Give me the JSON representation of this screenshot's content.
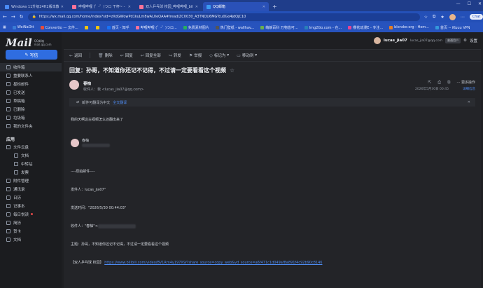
{
  "browser": {
    "tabs": [
      {
        "title": "Windows 11升级24H2版本教程",
        "active": false,
        "color": "#4a8bf5"
      },
      {
        "title": "哔哩哔哩 (゜-゜)つロ 干杯~ - bilibili",
        "active": false,
        "color": "#fb7299"
      },
      {
        "title": "双人乒乓球 校园_哔哩哔哩_bilibili",
        "active": false,
        "color": "#fb7299"
      },
      {
        "title": "QQ邮箱",
        "active": true,
        "color": "#3c9bf0"
      }
    ],
    "url": "https://wx.mail.qq.com/home/index?sid=zXdGWowPd1kuLm8wAL0eQAA#/read/ZC0030_A3TNQU6MGTcu0Go4jdQjC10",
    "chat_label": "Chat",
    "bookmarks": [
      {
        "label": "WeiNaOtt",
        "color": "#3a7bd5"
      },
      {
        "label": "Convertio — 文件...",
        "color": "#e74c3c"
      },
      {
        "label": "",
        "color": "#f1c40f"
      },
      {
        "label": "",
        "color": "#f1c40f"
      },
      {
        "label": "首页 - 知乎",
        "color": "#1772f6"
      },
      {
        "label": "哔哩哔哩 (゜-゜)つロ...",
        "color": "#fb7299"
      },
      {
        "label": "免费素材图片",
        "color": "#27ae60"
      },
      {
        "label": "热门壁纸 - wallhav...",
        "color": "#555555"
      },
      {
        "label": "萌娘百科 万物皆可...",
        "color": "#6ab04c"
      },
      {
        "label": "Img2Go.com - 在...",
        "color": "#2980b9"
      },
      {
        "label": "樱花动漫E - 专注...",
        "color": "#e84393"
      },
      {
        "label": "blender.org - Hom...",
        "color": "#e67e22"
      },
      {
        "label": "首页 -- iKuuu VPN",
        "color": "#3498db"
      }
    ]
  },
  "sidebar": {
    "logo_text": "Mail",
    "logo_sub1": "QQ邮箱",
    "logo_sub2": "mail.qq.com",
    "compose_label": "写信",
    "items": [
      {
        "label": "收件箱",
        "active": true
      },
      {
        "label": "重要联系人"
      },
      {
        "label": "星标邮件"
      },
      {
        "label": "已发送"
      },
      {
        "label": "草稿箱"
      },
      {
        "label": "已删除"
      },
      {
        "label": "垃圾箱"
      },
      {
        "label": "我的文件夹"
      }
    ],
    "apps_title": "应用",
    "apps": [
      {
        "label": "文件云盘",
        "sub": false
      },
      {
        "label": "文档",
        "sub": true
      },
      {
        "label": "中转站",
        "sub": true
      },
      {
        "label": "发票",
        "sub": true
      },
      {
        "label": "附件管理",
        "sub": false
      },
      {
        "label": "通讯录",
        "sub": false
      },
      {
        "label": "日历",
        "sub": false
      },
      {
        "label": "记事本",
        "sub": false
      },
      {
        "label": "每日悦读",
        "sub": false,
        "dot": true
      },
      {
        "label": "简历",
        "sub": false
      },
      {
        "label": "贺卡",
        "sub": false
      },
      {
        "label": "文档",
        "sub": false
      }
    ]
  },
  "user": {
    "name": "lucas_jia07",
    "email": "lucas_jia07@qq.com",
    "badge": "普通用户",
    "settings_label": "设置"
  },
  "toolbar": {
    "back": "返回",
    "delete": "删除",
    "reply": "回复",
    "reply_all": "回复全部",
    "forward": "转发",
    "report": "举报",
    "mark": "标记为",
    "move": "移动到"
  },
  "mail": {
    "subject": "回复：孙哥，不知道你还记不记得，不过请一定要看看这个视频",
    "star": "☆",
    "sender_name": "春柚",
    "recipient_line": "收件人：我 <lucas_jia07@qq.com>",
    "time": "2026年5月30日 00:45",
    "detail_label": "详细信息",
    "more_label": "更多操作",
    "translate_text": "邮件可翻译为中文",
    "translate_link": "全文翻译",
    "body_line1": "我的天啊这古视频怎么还翻出来了",
    "quote_name": "春柚",
    "orig_header": "----原始邮件----",
    "orig_from": "发件人：lucas_jia07\"",
    "orig_time": "发送时间：\"2026/5/30 00:44:03\"",
    "orig_to": "收件人：\"春柚\"<",
    "orig_subject": "主题：孙哥，不知道你还记不记得，不过请一定要看看这个视频",
    "orig_link_prefix": "【双人乒乓球  校园】",
    "orig_link": "https://www.bilibili.com/video/BV1Rm4y197X9/?share_source=copy_web&vd_source=a6f471c1d049af8a891f4c92b90c8146"
  },
  "colors": {
    "accent": "#2f6de0",
    "link": "#4d8af0",
    "chrome": "#2450b8"
  }
}
